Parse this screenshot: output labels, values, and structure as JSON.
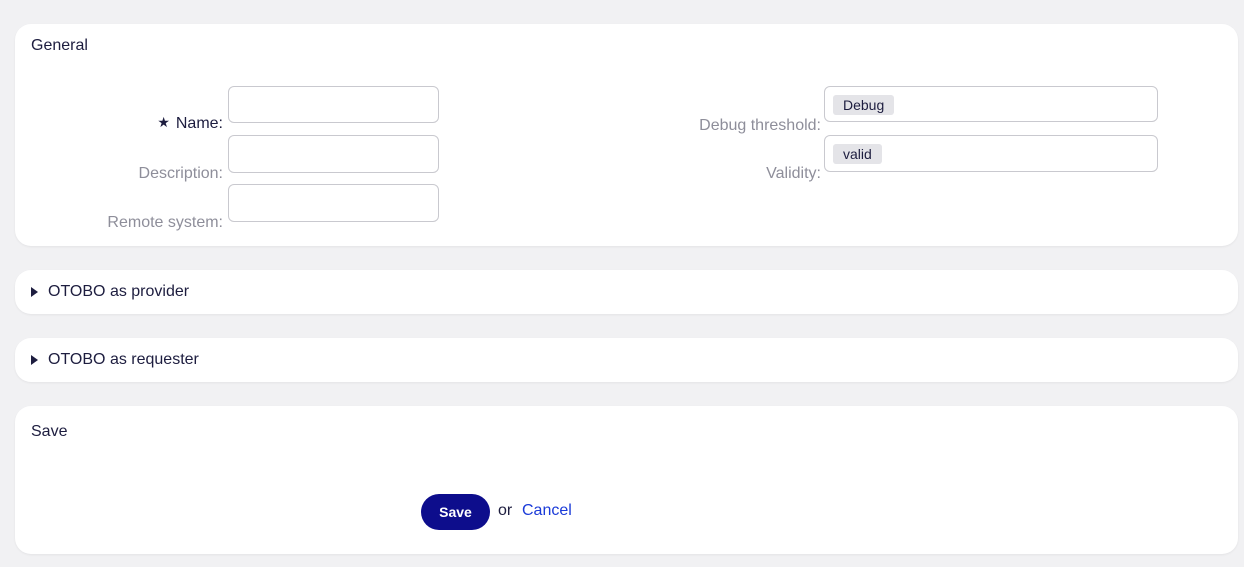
{
  "general": {
    "title": "General",
    "fields": {
      "name_label": "Name:",
      "name_value": "",
      "description_label": "Description:",
      "description_value": "",
      "remote_label": "Remote system:",
      "remote_value": "",
      "debug_label": "Debug threshold:",
      "debug_value": "Debug",
      "validity_label": "Validity:",
      "validity_value": "valid"
    },
    "required_marker": "★"
  },
  "provider": {
    "label": "OTOBO as provider"
  },
  "requester": {
    "label": "OTOBO as requester"
  },
  "save_section": {
    "title": "Save",
    "save_label": "Save",
    "or_text": "or",
    "cancel_label": "Cancel"
  },
  "colors": {
    "primary_button": "#0d0d8c",
    "link": "#1a3ad8",
    "background": "#f1f1f3"
  }
}
